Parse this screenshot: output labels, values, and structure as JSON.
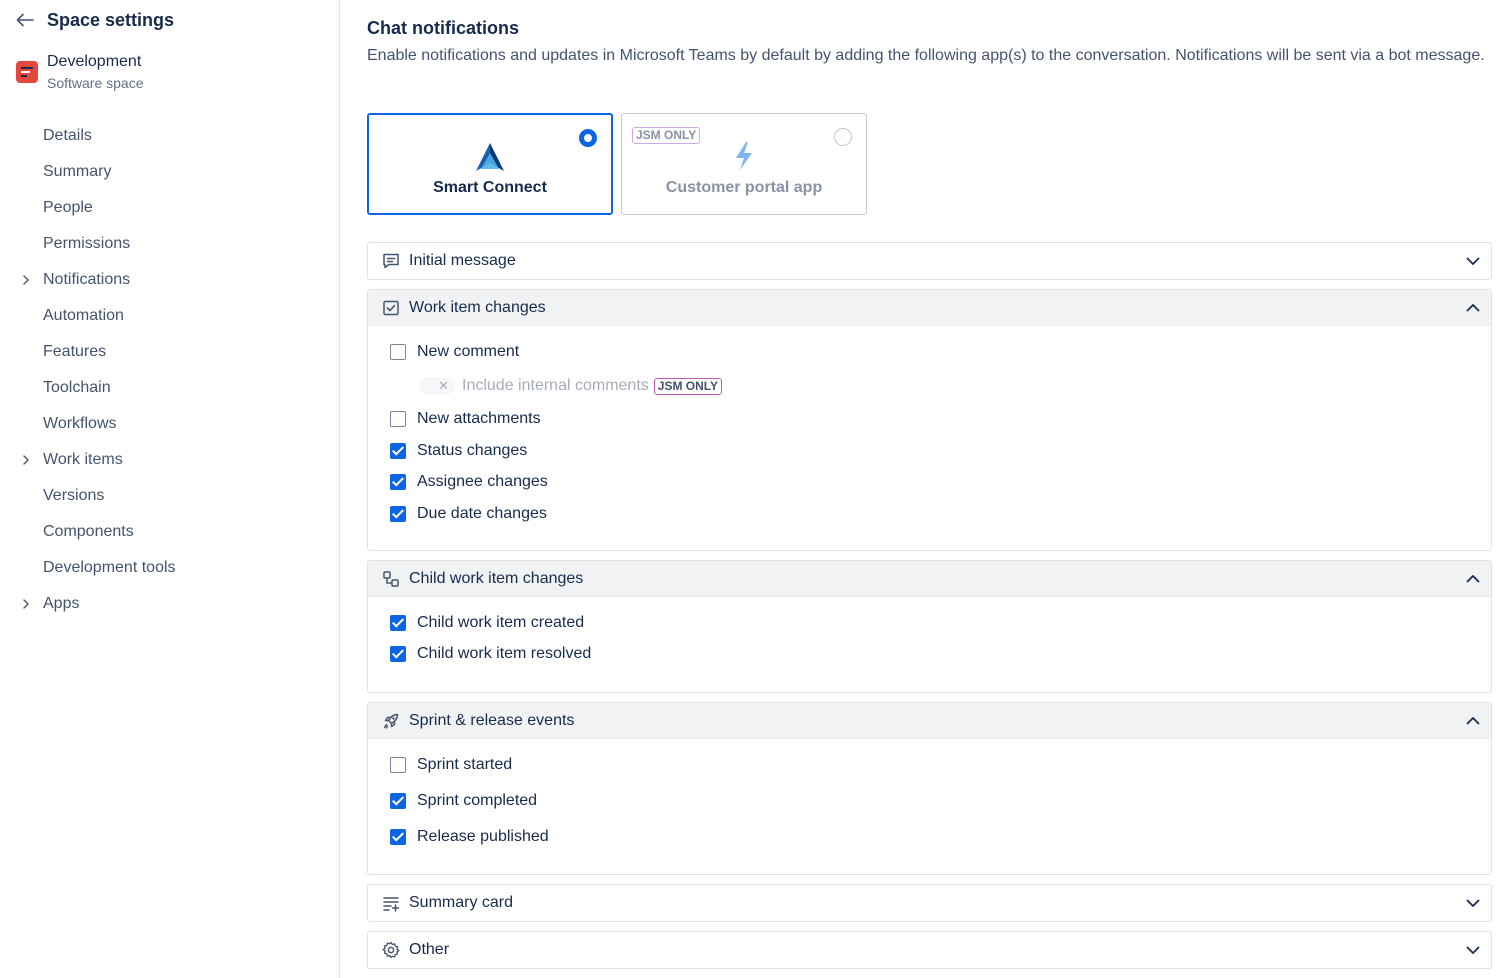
{
  "sidebar": {
    "title": "Space settings",
    "space": {
      "name": "Development",
      "type": "Software space"
    },
    "items": [
      {
        "label": "Details",
        "expandable": false
      },
      {
        "label": "Summary",
        "expandable": false
      },
      {
        "label": "People",
        "expandable": false
      },
      {
        "label": "Permissions",
        "expandable": false
      },
      {
        "label": "Notifications",
        "expandable": true
      },
      {
        "label": "Automation",
        "expandable": false
      },
      {
        "label": "Features",
        "expandable": false
      },
      {
        "label": "Toolchain",
        "expandable": false
      },
      {
        "label": "Workflows",
        "expandable": false
      },
      {
        "label": "Work items",
        "expandable": true
      },
      {
        "label": "Versions",
        "expandable": false
      },
      {
        "label": "Components",
        "expandable": false
      },
      {
        "label": "Development tools",
        "expandable": false
      },
      {
        "label": "Apps",
        "expandable": true
      }
    ]
  },
  "main": {
    "title": "Chat notifications",
    "description": "Enable notifications and updates in Microsoft Teams by default by adding the following app(s) to the conversation. Notifications will be sent via a bot message.",
    "apps": [
      {
        "label": "Smart Connect",
        "selected": true
      },
      {
        "label": "Customer portal app",
        "selected": false,
        "badge": "JSM ONLY"
      }
    ],
    "sections": {
      "initial_message": {
        "title": "Initial message",
        "expanded": false
      },
      "work_item_changes": {
        "title": "Work item changes",
        "expanded": true,
        "new_comment": {
          "label": "New comment",
          "checked": false
        },
        "include_internal": {
          "label": "Include internal comments",
          "badge": "JSM ONLY",
          "on": false
        },
        "new_attachments": {
          "label": "New attachments",
          "checked": false
        },
        "status_changes": {
          "label": "Status changes",
          "checked": true
        },
        "assignee_changes": {
          "label": "Assignee changes",
          "checked": true
        },
        "due_date_changes": {
          "label": "Due date changes",
          "checked": true
        }
      },
      "child_work_item_changes": {
        "title": "Child work item changes",
        "expanded": true,
        "created": {
          "label": "Child work item created",
          "checked": true
        },
        "resolved": {
          "label": "Child work item resolved",
          "checked": true
        }
      },
      "sprint_release": {
        "title": "Sprint & release events",
        "expanded": true,
        "sprint_started": {
          "label": "Sprint started",
          "checked": false
        },
        "sprint_completed": {
          "label": "Sprint completed",
          "checked": true
        },
        "release_published": {
          "label": "Release published",
          "checked": true
        }
      },
      "summary_card": {
        "title": "Summary card",
        "expanded": false
      },
      "other": {
        "title": "Other",
        "expanded": false
      }
    }
  },
  "colors": {
    "accent": "#0c66e4",
    "text": "#172b4d",
    "subtle_text": "#44546f",
    "section_header_bg": "#f1f2f4",
    "space_logo": "#e2483d"
  }
}
